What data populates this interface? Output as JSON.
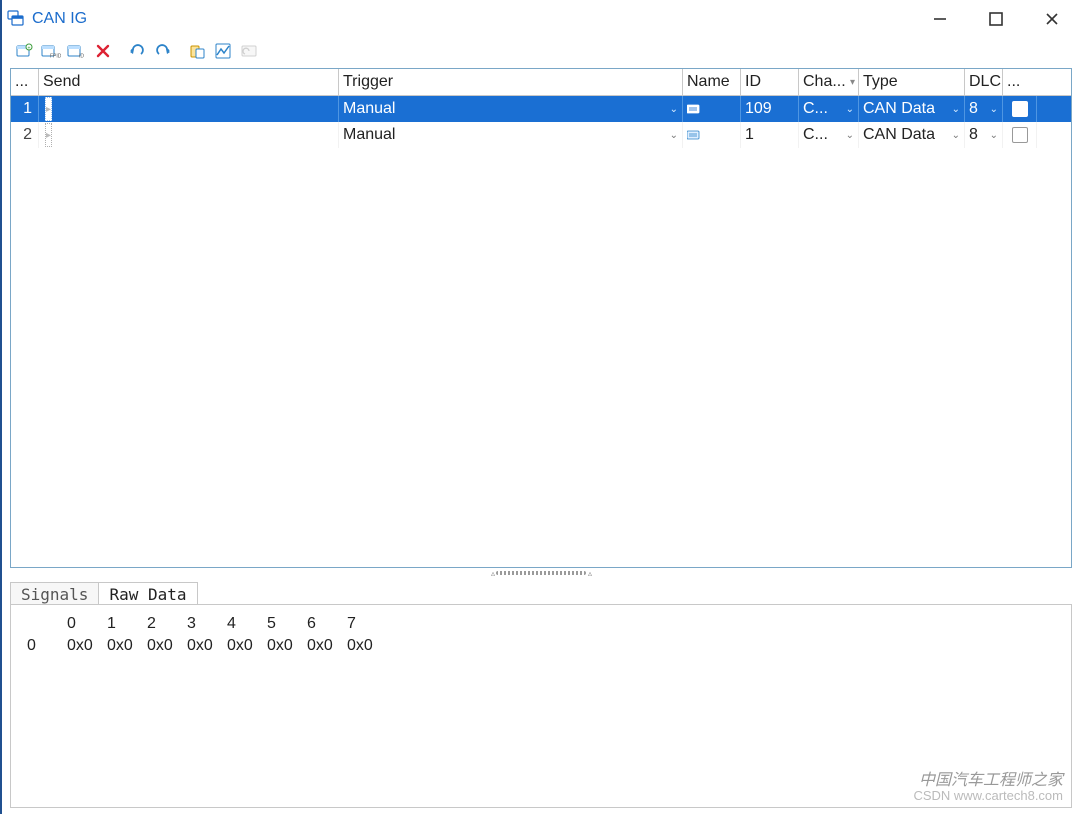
{
  "window": {
    "title": "CAN IG"
  },
  "toolbar": {
    "btn1": "new-frame-icon",
    "btn2": "new-frame-id-icon",
    "btn3": "new-frame-db-icon",
    "btn4": "delete-icon",
    "btn5": "undo-icon",
    "btn6": "redo-icon",
    "btn7": "paste-icon",
    "btn8": "signal-graph-icon",
    "btn9": "dim-icon"
  },
  "grid": {
    "columns": {
      "menu": "...",
      "send": "Send",
      "trigger": "Trigger",
      "name": "Name",
      "id": "ID",
      "channel": "Cha...",
      "type": "Type",
      "dlc": "DLC",
      "more": "..."
    },
    "rows": [
      {
        "index": "1",
        "send": "",
        "trigger": "Manual",
        "name": "",
        "id": "109",
        "channel": "C...",
        "type": "CAN Data",
        "dlc": "8",
        "selected": true,
        "checked": false
      },
      {
        "index": "2",
        "send": "",
        "trigger": "Manual",
        "name": "",
        "id": "1",
        "channel": "C...",
        "type": "CAN Data",
        "dlc": "8",
        "selected": false,
        "checked": false
      }
    ]
  },
  "bottom": {
    "tabs": {
      "signals": "Signals",
      "rawdata": "Raw Data"
    },
    "rawdata": {
      "columns": [
        "0",
        "1",
        "2",
        "3",
        "4",
        "5",
        "6",
        "7"
      ],
      "rows": [
        {
          "label": "0",
          "values": [
            "0x0",
            "0x0",
            "0x0",
            "0x0",
            "0x0",
            "0x0",
            "0x0",
            "0x0"
          ]
        }
      ]
    }
  },
  "watermark": {
    "line1": "中国汽车工程师之家",
    "line2": "CSDN www.cartech8.com"
  }
}
